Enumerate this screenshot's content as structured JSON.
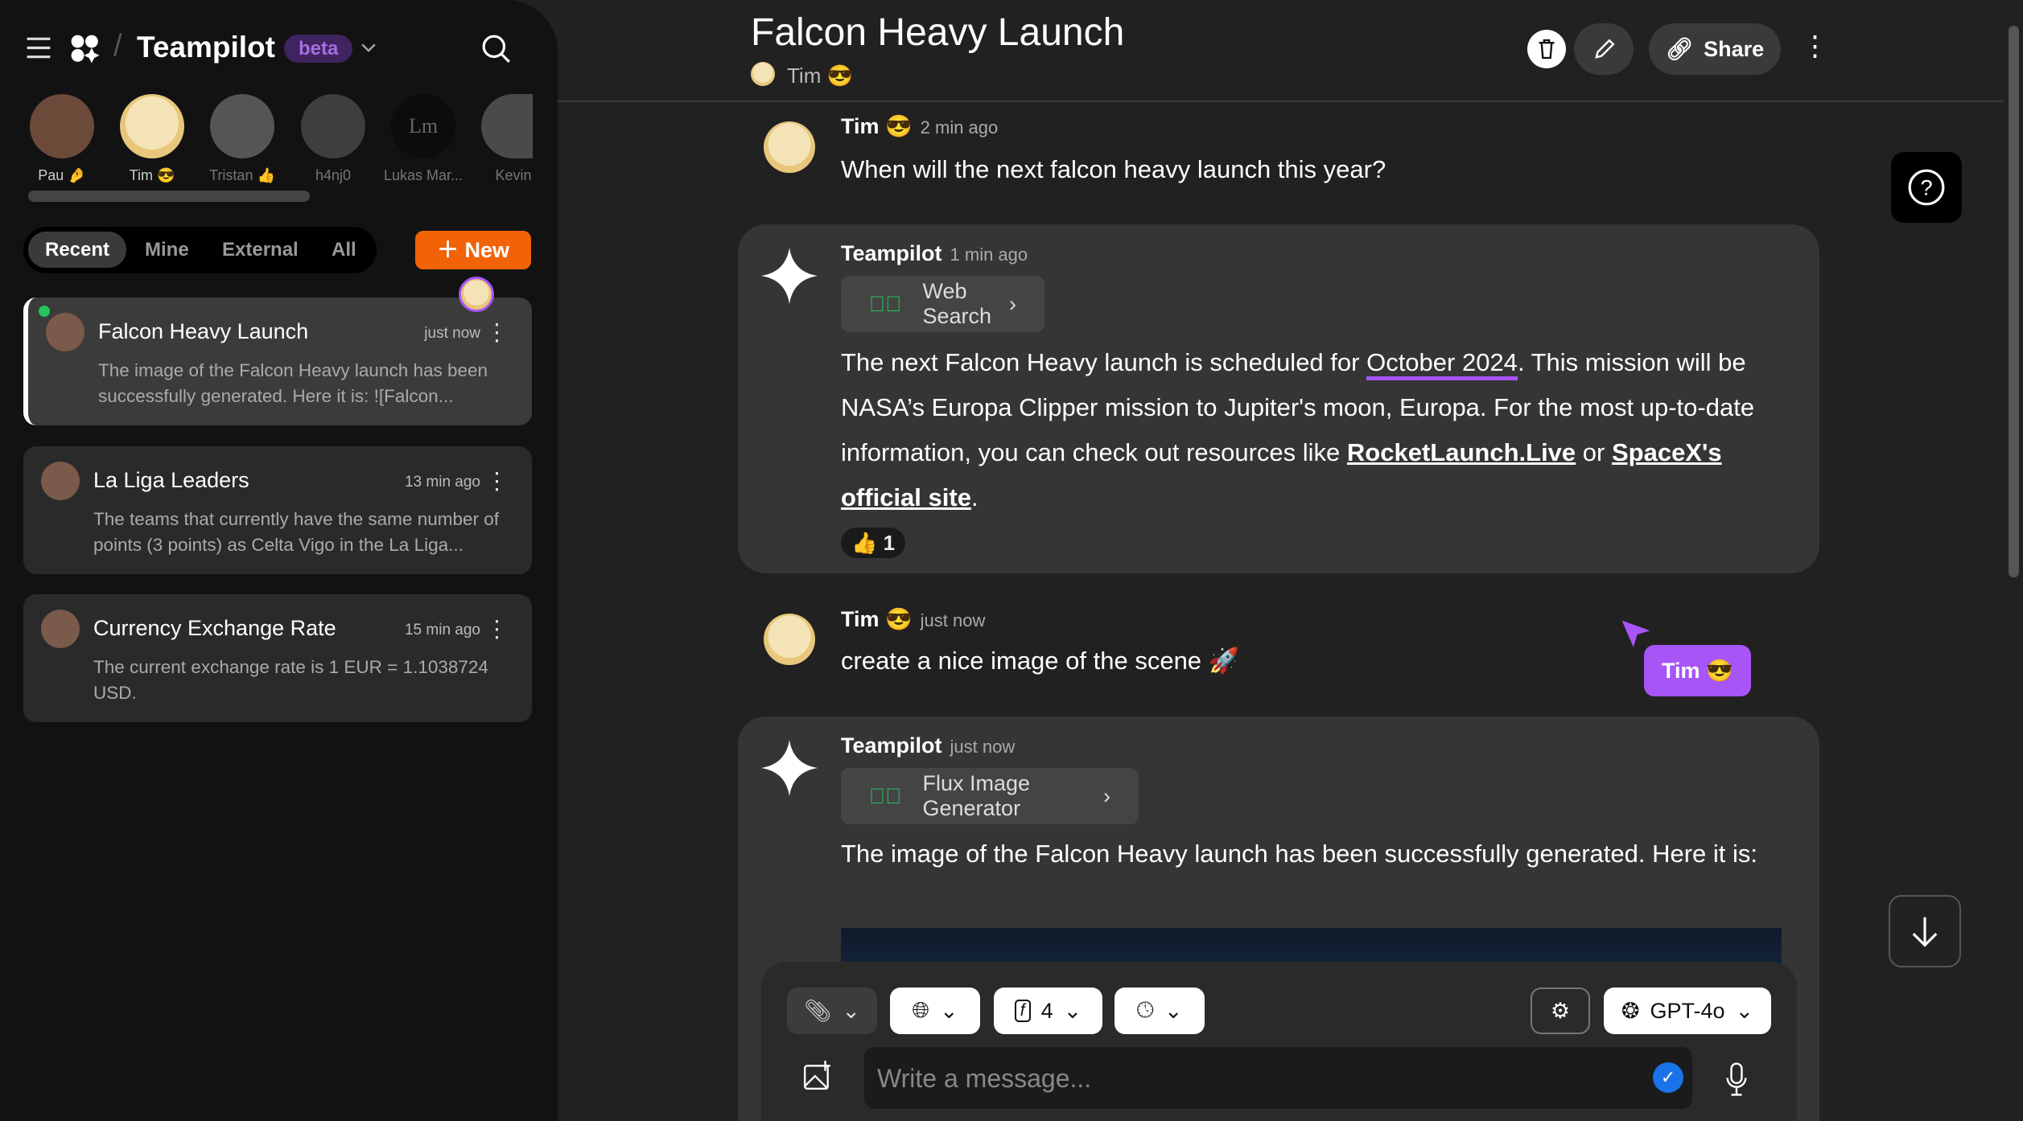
{
  "sidebar": {
    "app_name": "Teampilot",
    "badge": "beta",
    "users": [
      {
        "name": "Pau 🤌"
      },
      {
        "name": "Tim 😎"
      },
      {
        "name": "Tristan 👍"
      },
      {
        "name": "h4nj0"
      },
      {
        "name": "Lukas Mar..."
      },
      {
        "name": "Kevin"
      }
    ],
    "lukas_initials": "Lm",
    "tabs": [
      {
        "label": "Recent"
      },
      {
        "label": "Mine"
      },
      {
        "label": "External"
      },
      {
        "label": "All"
      }
    ],
    "new_label": "New",
    "conversations": [
      {
        "title": "Falcon Heavy Launch",
        "time": "just now",
        "preview": "The image of the Falcon Heavy launch has been successfully generated. Here it is: ![Falcon..."
      },
      {
        "title": "La Liga Leaders",
        "time": "13 min ago",
        "preview": "The teams that currently have the same number of points (3 points) as Celta Vigo in the La Liga..."
      },
      {
        "title": "Currency Exchange Rate",
        "time": "15 min ago",
        "preview": "The current exchange rate is 1 EUR = 1.1038724 USD."
      }
    ]
  },
  "header": {
    "title": "Falcon Heavy Launch",
    "owner": "Tim 😎",
    "share": "Share"
  },
  "messages": [
    {
      "author": "Tim 😎",
      "time": "2 min ago",
      "text": "When will the next falcon heavy launch this year?"
    },
    {
      "author": "Teampilot",
      "time": "1 min ago",
      "tool": "Web Search",
      "text_a": "The next Falcon Heavy launch is scheduled for ",
      "highlight": "October 2024",
      "text_b": ". This mission will be NASA’s Europa Clipper mission to Jupiter's moon, Europa. For the most up-to-date information, you can check out resources like ",
      "link1": "RocketLaunch.Live",
      "text_c": " or ",
      "link2": "SpaceX's official site",
      "text_d": ".",
      "reaction": "👍",
      "reaction_count": "1"
    },
    {
      "author": "Tim 😎",
      "time": "just now",
      "text": "create a nice image of the scene 🚀"
    },
    {
      "author": "Teampilot",
      "time": "just now",
      "tool": "Flux Image Generator",
      "text": "The image of the Falcon Heavy launch has been successfully generated. Here it is:"
    }
  ],
  "cursor_label": "Tim 😎",
  "composer": {
    "placeholder": "Write a message...",
    "flux_count": "4",
    "model": "GPT-4o"
  },
  "colors": {
    "accent": "#f26207",
    "badge": "#a86ee0",
    "cursor": "#a855f7",
    "online": "#22c55e"
  }
}
